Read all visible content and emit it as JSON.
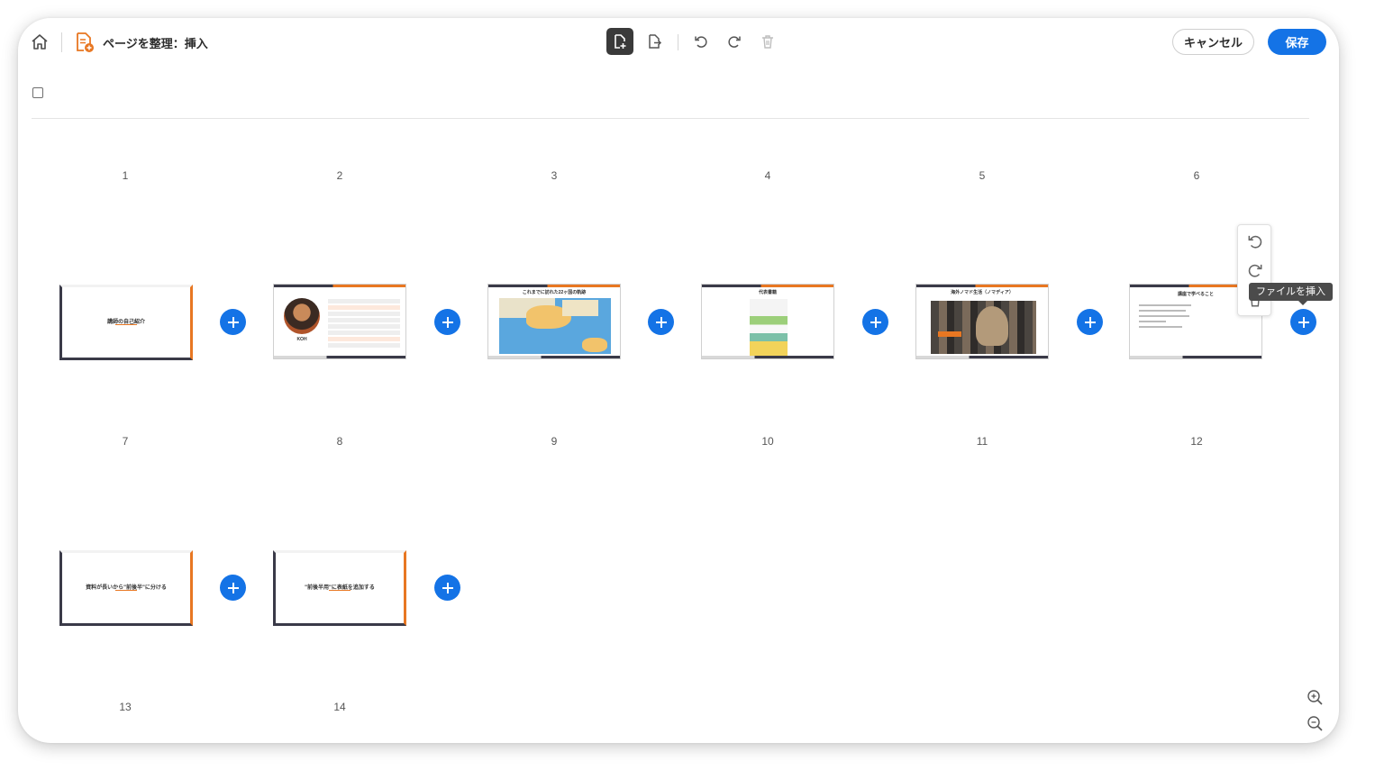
{
  "header": {
    "title": "ページを整理：挿入",
    "cancel_label": "キャンセル",
    "save_label": "保存",
    "accent": "#1473e6"
  },
  "pages": [
    {
      "number": "1",
      "title": "講師の自己紹介",
      "kind": "title"
    },
    {
      "number": "2",
      "kind": "profile",
      "name": "KOH"
    },
    {
      "number": "3",
      "title": "これまでに訪れた22ヶ国の軌跡",
      "kind": "map"
    },
    {
      "number": "4",
      "title": "代表書籍",
      "kind": "book"
    },
    {
      "number": "5",
      "title": "海外ノマド生活（ノマディア）",
      "kind": "photo"
    },
    {
      "number": "6",
      "title": "講座で学べること",
      "kind": "list"
    },
    {
      "number": "7",
      "kind": "blank"
    },
    {
      "number": "8",
      "kind": "blank"
    },
    {
      "number": "9",
      "kind": "blank"
    },
    {
      "number": "10",
      "kind": "blank"
    },
    {
      "number": "11",
      "kind": "blank"
    },
    {
      "number": "12",
      "kind": "blank"
    },
    {
      "number": "13",
      "title": "資料が長いから\"前後半\"に分ける",
      "kind": "title"
    },
    {
      "number": "14",
      "title": "\"前後半用\"に表紙を追加する",
      "kind": "title"
    }
  ],
  "popup": {
    "tooltip": "ファイルを挿入"
  }
}
